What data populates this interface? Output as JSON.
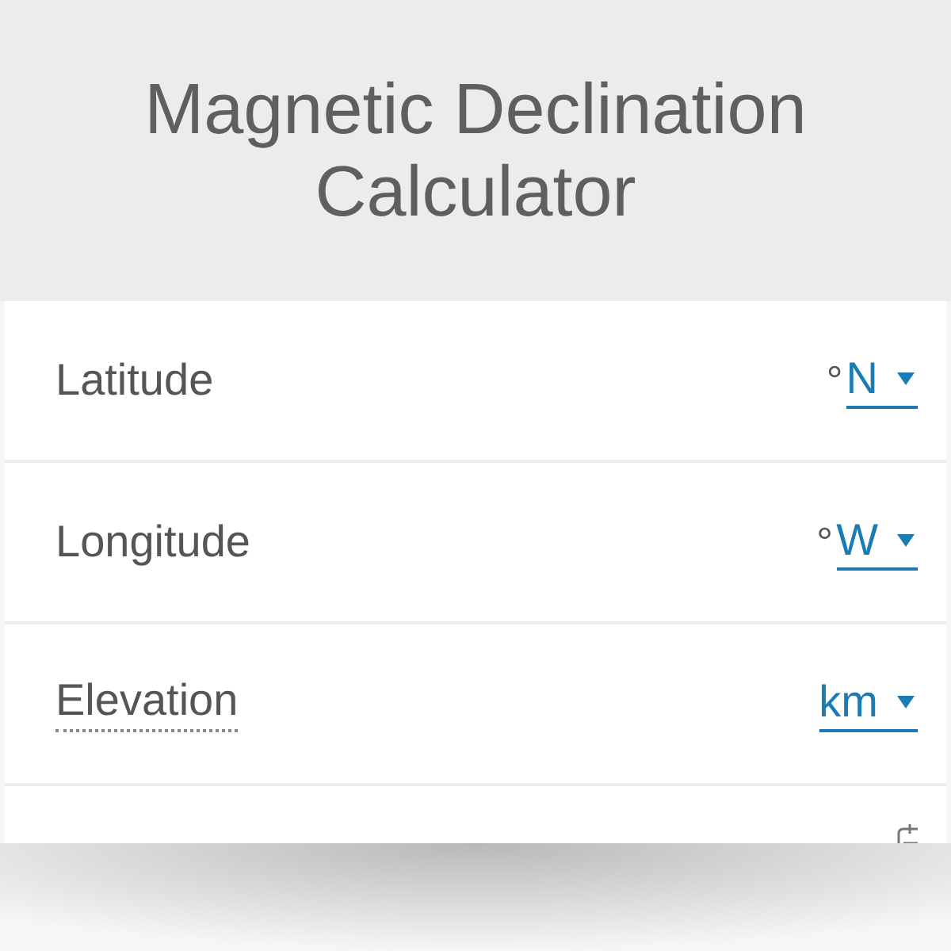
{
  "title": "Magnetic Declination Calculator",
  "fields": [
    {
      "label": "Latitude",
      "hint": false,
      "prefix": "°",
      "unit": "N"
    },
    {
      "label": "Longitude",
      "hint": false,
      "prefix": "°",
      "unit": "W"
    },
    {
      "label": "Elevation",
      "hint": true,
      "unit": "km"
    }
  ]
}
